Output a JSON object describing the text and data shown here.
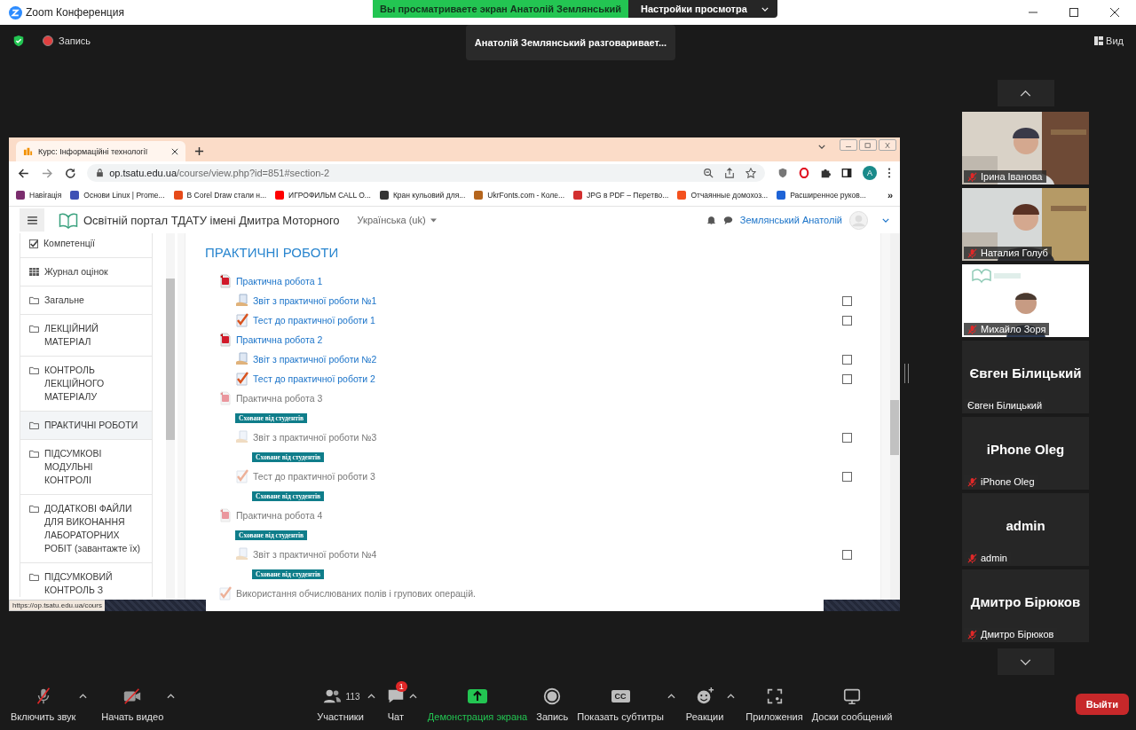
{
  "window": {
    "title": "Zoom Конференция"
  },
  "share_banner": {
    "text": "Вы просматриваете экран Анатолій Землянський",
    "settings": "Настройки просмотра"
  },
  "meeting_bar": {
    "record": "Запись",
    "speaking": "Анатолій Землянський разговаривает...",
    "view": "Вид"
  },
  "browser": {
    "tab": {
      "title": "Курс: Інформаційні технології"
    },
    "url": {
      "host": "op.tsatu.edu.ua",
      "path": "/course/view.php?id=851#section-2"
    },
    "profile": "A",
    "bookmarks": [
      {
        "label": "Навігація",
        "color": "#7b2d6e"
      },
      {
        "label": "Основи Linux | Prome...",
        "color": "#3f51b5"
      },
      {
        "label": "В Corel Draw стали н...",
        "color": "#e64a19"
      },
      {
        "label": "ИГРОФИЛЬМ CALL O...",
        "color": "#ff0000"
      },
      {
        "label": "Кран кульовий для...",
        "color": "#333333"
      },
      {
        "label": "UkrFonts.com - Коле...",
        "color": "#b5651d"
      },
      {
        "label": "JPG в PDF – Перетво...",
        "color": "#d32f2f"
      },
      {
        "label": "Отчаянные домохоз...",
        "color": "#f4511e"
      },
      {
        "label": "Расширенное руков...",
        "color": "#1e63d6"
      }
    ],
    "more_bookmarks": "»",
    "status_url": "https://op.tsatu.edu.ua/cours"
  },
  "moodle": {
    "site_name": "Освітній портал ТДАТУ імені Дмитра Моторного",
    "language": "Українська (uk)",
    "user": "Землянський Анатолій",
    "nav": [
      {
        "kind": "competency",
        "label": "Компетенції",
        "selected": false
      },
      {
        "kind": "grades",
        "label": "Журнал оцінок",
        "selected": false
      },
      {
        "kind": "section",
        "label": "Загальне",
        "selected": false
      },
      {
        "kind": "section",
        "label": "ЛЕКЦІЙНИЙ МАТЕРІАЛ",
        "selected": false
      },
      {
        "kind": "section",
        "label": "КОНТРОЛЬ ЛЕКЦІЙНОГО МАТЕРІАЛУ",
        "selected": false
      },
      {
        "kind": "section",
        "label": "ПРАКТИЧНІ РОБОТИ",
        "selected": true
      },
      {
        "kind": "section",
        "label": "ПІДСУМКОВІ МОДУЛЬНІ КОНТРОЛІ",
        "selected": false
      },
      {
        "kind": "section",
        "label": "ДОДАТКОВІ ФАЙЛИ ДЛЯ ВИКОНАННЯ ЛАБОРАТОРНИХ РОБІТ (завантажте їх)",
        "selected": false
      },
      {
        "kind": "section",
        "label": "ПІДСУМКОВИЙ КОНТРОЛЬ З",
        "selected": false
      }
    ],
    "section": {
      "title": "ПРАКТИЧНІ РОБОТИ",
      "activities": [
        {
          "kind": "file",
          "title": "Практична робота 1",
          "hidden": false,
          "children": [
            {
              "kind": "assign",
              "title": "Звіт з практичної роботи №1",
              "hidden": false,
              "completion": {
                "checked": false
              }
            },
            {
              "kind": "quiz",
              "title": "Тест до практичної роботи 1",
              "hidden": false,
              "completion": {
                "checked": false
              }
            }
          ]
        },
        {
          "kind": "file",
          "title": "Практична робота 2",
          "hidden": false,
          "children": [
            {
              "kind": "assign",
              "title": "Звіт з практичної роботи №2",
              "hidden": false,
              "completion": {
                "checked": false
              }
            },
            {
              "kind": "quiz",
              "title": "Тест до практичної роботи 2",
              "hidden": false,
              "completion": {
                "checked": false
              }
            }
          ]
        },
        {
          "kind": "file",
          "title": "Практична робота 3",
          "hidden": true,
          "badge": "Сховане від студентів",
          "children": [
            {
              "kind": "assign",
              "title": "Звіт з практичної роботи №3",
              "hidden": true,
              "badge": "Сховане від студентів",
              "completion": {
                "checked": false
              }
            },
            {
              "kind": "quiz",
              "title": "Тест до практичної роботи 3",
              "hidden": true,
              "badge": "Сховане від студентів",
              "completion": {
                "checked": false
              }
            }
          ]
        },
        {
          "kind": "file",
          "title": "Практична робота 4",
          "hidden": true,
          "badge": "Сховане від студентів",
          "children": [
            {
              "kind": "assign",
              "title": "Звіт з практичної роботи №4",
              "hidden": true,
              "badge": "Сховане від студентів",
              "completion": {
                "checked": false
              }
            }
          ]
        },
        {
          "kind": "quiz",
          "title": "Використання обчислюваних полів і групових операцій.",
          "hidden": true
        }
      ]
    }
  },
  "participants": [
    {
      "kind": "video",
      "name": "Ірина Іванова",
      "muted": true
    },
    {
      "kind": "video",
      "name": "Наталия Голуб",
      "muted": true
    },
    {
      "kind": "video",
      "name": "Михайло Зоря",
      "muted": true
    },
    {
      "kind": "name",
      "display": "Євген Білицький",
      "name": "Євген Білицький",
      "muted": false
    },
    {
      "kind": "name",
      "display": "iPhone Oleg",
      "name": "iPhone Oleg",
      "muted": true
    },
    {
      "kind": "name",
      "display": "admin",
      "name": "admin",
      "muted": true
    },
    {
      "kind": "name",
      "display": "Дмитро Бірюков",
      "name": "Дмитро Бірюков",
      "muted": true
    }
  ],
  "toolbar": {
    "left": [
      {
        "kind": "mic",
        "label": "Включить звук",
        "muted": true,
        "caret": true,
        "active": false
      },
      {
        "kind": "camera",
        "label": "Начать видео",
        "muted": true,
        "caret": true,
        "active": false
      }
    ],
    "center": [
      {
        "kind": "participants",
        "label": "Участники",
        "count": "113",
        "caret": true,
        "active": false
      },
      {
        "kind": "chat",
        "label": "Чат",
        "badge": "1",
        "caret": true,
        "active": false
      },
      {
        "kind": "share",
        "label": "Демонстрация экрана",
        "caret": false,
        "active": true
      },
      {
        "kind": "record",
        "label": "Запись",
        "caret": false,
        "active": false
      },
      {
        "kind": "captions",
        "label": "Показать субтитры",
        "icon_text": "CC",
        "caret": true,
        "active": false
      },
      {
        "kind": "reactions",
        "label": "Реакции",
        "caret": true,
        "active": false
      },
      {
        "kind": "apps",
        "label": "Приложения",
        "caret": false,
        "active": false
      },
      {
        "kind": "whiteboard",
        "label": "Доски сообщений",
        "caret": false,
        "active": false
      }
    ],
    "leave": "Выйти"
  }
}
